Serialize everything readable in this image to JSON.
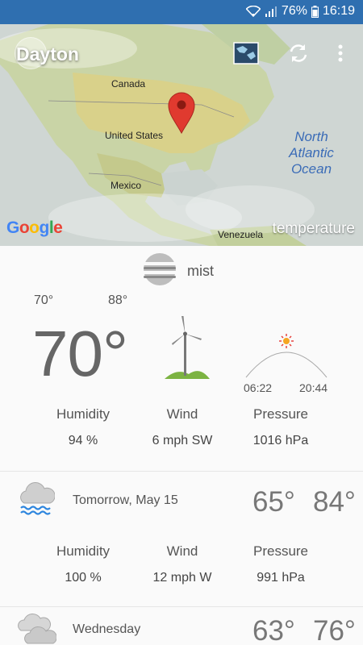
{
  "status_bar": {
    "battery": "76%",
    "time": "16:19"
  },
  "map": {
    "city": "Dayton",
    "labels": {
      "canada": "Canada",
      "us": "United States",
      "mexico": "Mexico",
      "venezuela": "Venezuela",
      "ocean": "North Atlantic Ocean"
    },
    "attribution": "Google",
    "layer": "temperature"
  },
  "current": {
    "condition": "mist",
    "low": "70°",
    "high": "88°",
    "temperature": "70°",
    "sunrise": "06:22",
    "sunset": "20:44",
    "humidity_label": "Humidity",
    "humidity": "94 %",
    "wind_label": "Wind",
    "wind": "6 mph SW",
    "pressure_label": "Pressure",
    "pressure": "1016 hPa"
  },
  "forecast": [
    {
      "day": "Tomorrow, May 15",
      "low": "65°",
      "high": "84°",
      "icon": "rain-cloud-icon",
      "humidity_label": "Humidity",
      "humidity": "100 %",
      "wind_label": "Wind",
      "wind": "12 mph W",
      "pressure_label": "Pressure",
      "pressure": "991 hPa"
    },
    {
      "day": "Wednesday",
      "low": "63°",
      "high": "76°",
      "icon": "cloud-icon"
    }
  ]
}
